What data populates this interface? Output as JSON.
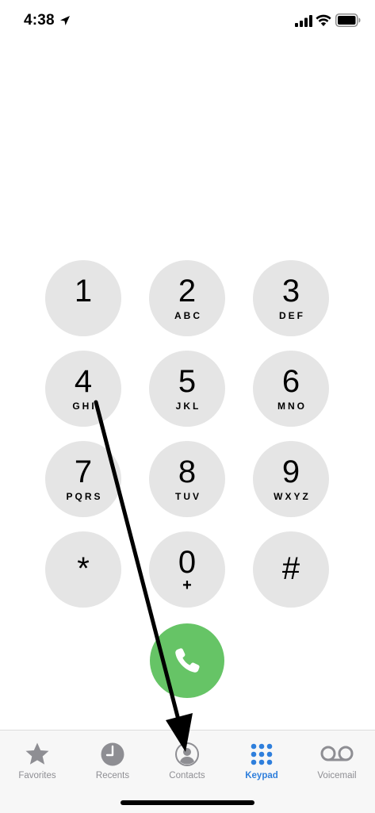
{
  "status_bar": {
    "time": "4:38"
  },
  "keypad": {
    "keys": [
      {
        "digit": "1",
        "letters": ""
      },
      {
        "digit": "2",
        "letters": "ABC"
      },
      {
        "digit": "3",
        "letters": "DEF"
      },
      {
        "digit": "4",
        "letters": "GHI"
      },
      {
        "digit": "5",
        "letters": "JKL"
      },
      {
        "digit": "6",
        "letters": "MNO"
      },
      {
        "digit": "7",
        "letters": "PQRS"
      },
      {
        "digit": "8",
        "letters": "TUV"
      },
      {
        "digit": "9",
        "letters": "WXYZ"
      },
      {
        "digit": "*",
        "letters": ""
      },
      {
        "digit": "0",
        "letters": "+"
      },
      {
        "digit": "#",
        "letters": ""
      }
    ]
  },
  "call_button": {
    "icon": "phone-icon",
    "color": "#66c466"
  },
  "tab_bar": {
    "tabs": [
      {
        "label": "Favorites",
        "icon": "star-icon"
      },
      {
        "label": "Recents",
        "icon": "clock-icon"
      },
      {
        "label": "Contacts",
        "icon": "contacts-icon"
      },
      {
        "label": "Keypad",
        "icon": "keypad-icon"
      },
      {
        "label": "Voicemail",
        "icon": "voicemail-icon"
      }
    ],
    "active_tab": "Keypad",
    "active_color": "#2f7fdc",
    "inactive_color": "#8e8e93"
  }
}
